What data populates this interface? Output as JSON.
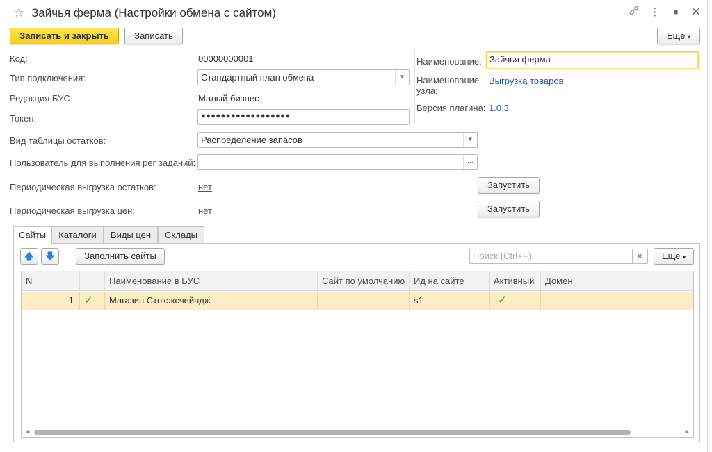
{
  "window": {
    "title": "Зайчья ферма (Настройки обмена с сайтом)"
  },
  "toolbar": {
    "save_close_label": "Записать и закрыть",
    "save_label": "Записать",
    "more_label": "Еще"
  },
  "form": {
    "code_label": "Код:",
    "code_value": "00000000001",
    "connection_type_label": "Тип подключения:",
    "connection_type_value": "Стандартный план обмена",
    "bus_edition_label": "Редакция БУС:",
    "bus_edition_value": "Малый бизнес",
    "token_label": "Токен:",
    "token_value": "●●●●●●●●●●●●●●●●●●",
    "stock_table_label": "Вид таблицы остатков:",
    "stock_table_value": "Распределение запасов",
    "user_label": "Пользователь для выполнения рег заданий:",
    "user_value": "",
    "user_select_label": "...",
    "periodic_stock_label": "Периодическая выгрузка остатков:",
    "periodic_stock_value": "нет",
    "periodic_prices_label": "Периодическая выгрузка цен:",
    "periodic_prices_value": "нет",
    "run_label": "Запустить",
    "name_label": "Наименование:",
    "name_value": "Зайчья ферма",
    "node_name_label_line1": "Наименование",
    "node_name_label_line2": "узла:",
    "node_name_value": "Выгрузка товаров",
    "plugin_version_label": "Версия плагина:",
    "plugin_version_value": "1.0.3"
  },
  "tabs": [
    {
      "label": "Сайты"
    },
    {
      "label": "Каталоги"
    },
    {
      "label": "Виды цен"
    },
    {
      "label": "Склады"
    }
  ],
  "sites_panel": {
    "fill_label": "Заполнить сайты",
    "search_placeholder": "Поиск (Ctrl+F)",
    "clear_label": "×",
    "more_label": "Еще",
    "columns": [
      "N",
      "",
      "Наименование в БУС",
      "Сайт по умолчанию",
      "Ид на сайте",
      "Активный",
      "Домен"
    ],
    "rows": [
      {
        "n": "1",
        "checked": "✓",
        "name": "Магазин Стокэксчейндж",
        "default_site": "",
        "site_id": "s1",
        "active": "✓",
        "domain": ""
      }
    ]
  },
  "colors": {
    "accent": "#f7cf16",
    "link": "#1a57b0",
    "row_selected": "#fbeec4",
    "check": "#22a43c"
  },
  "icons": [
    "star-icon",
    "link-icon",
    "kebab-icon",
    "maximize-icon",
    "close-icon",
    "arrow-up-icon",
    "arrow-down-icon",
    "chevron-down-icon"
  ]
}
